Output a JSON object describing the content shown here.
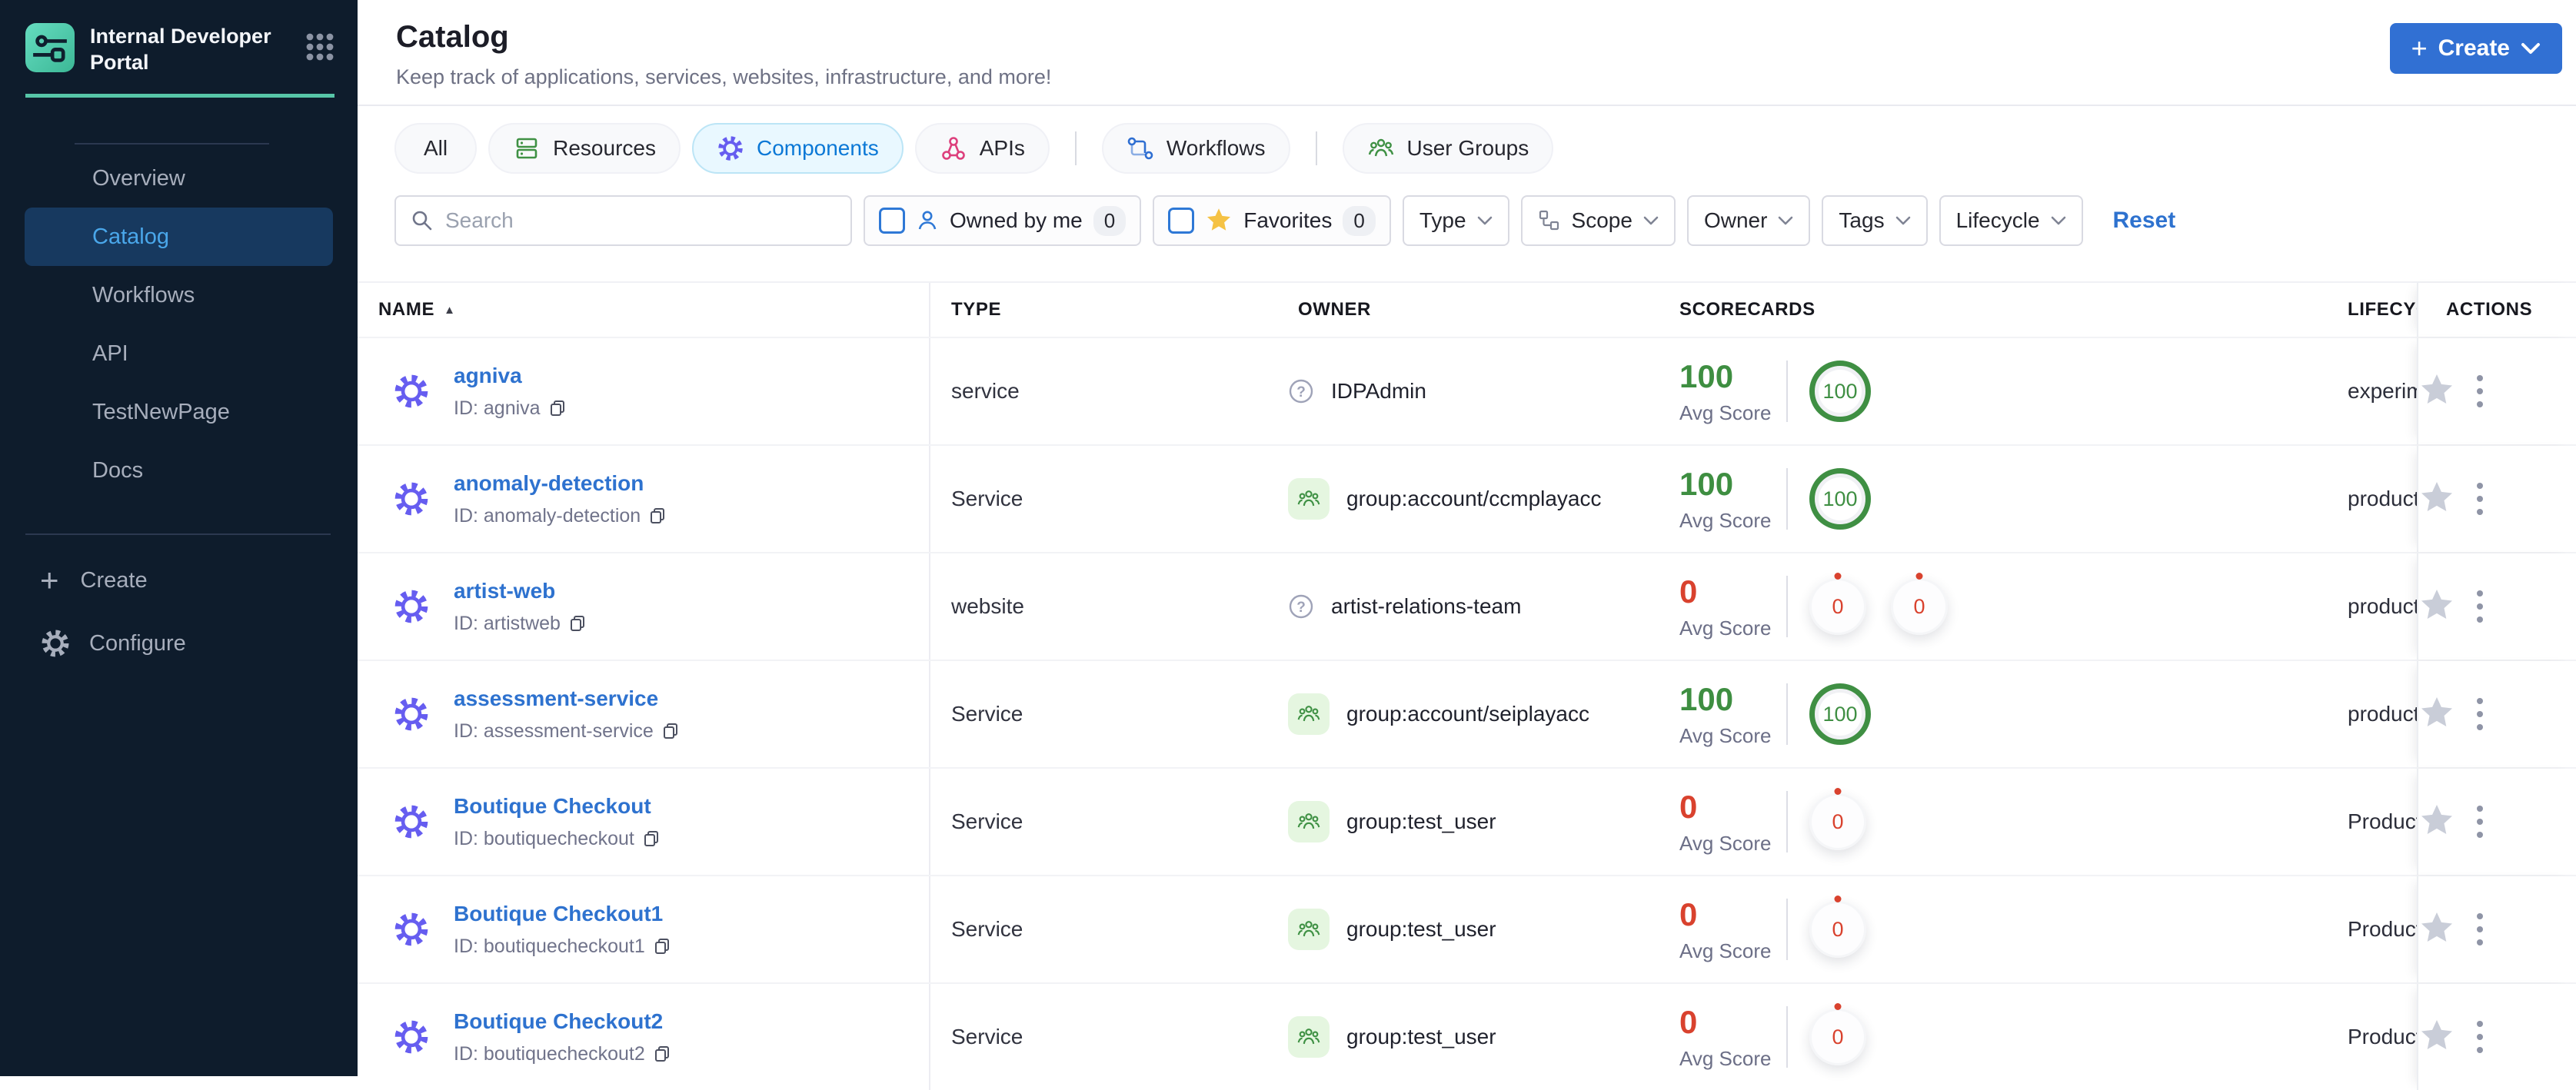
{
  "sidebar": {
    "logo_title": "Internal Developer Portal",
    "nav": [
      "Overview",
      "Catalog",
      "Workflows",
      "API",
      "TestNewPage",
      "Docs"
    ],
    "active_nav": "Catalog",
    "create_label": "Create",
    "configure_label": "Configure"
  },
  "header": {
    "title": "Catalog",
    "subtitle": "Keep track of applications, services, websites, infrastructure, and more!",
    "create_button_label": "Create"
  },
  "tabs": {
    "items": [
      "All",
      "Resources",
      "Components",
      "APIs",
      "Workflows",
      "User Groups"
    ],
    "active": "Components"
  },
  "filters": {
    "search_placeholder": "Search",
    "owned_by_me": {
      "label": "Owned by me",
      "count": "0",
      "checked": false
    },
    "favorites": {
      "label": "Favorites",
      "count": "0",
      "checked": false
    },
    "dropdowns": [
      "Type",
      "Scope",
      "Owner",
      "Tags",
      "Lifecycle"
    ],
    "reset_label": "Reset"
  },
  "table": {
    "columns": [
      "NAME",
      "TYPE",
      "OWNER",
      "SCORECARDS",
      "LIFECYCLE",
      "ACTIONS"
    ],
    "sorted_by": "NAME ascending",
    "avg_score_label": "Avg Score",
    "rows": [
      {
        "name": "agniva",
        "id": "ID: agniva",
        "type": "service",
        "owner": "IDPAdmin",
        "owner_kind": "unknown",
        "score": "100",
        "score_state": "good",
        "circles": [
          "100"
        ],
        "lifecycle": "experimental"
      },
      {
        "name": "anomaly-detection",
        "id": "ID: anomaly-detection",
        "type": "Service",
        "owner": "group:account/ccmplayacc",
        "owner_kind": "group",
        "score": "100",
        "score_state": "good",
        "circles": [
          "100"
        ],
        "lifecycle": "production"
      },
      {
        "name": "artist-web",
        "id": "ID: artistweb",
        "type": "website",
        "owner": "artist-relations-team",
        "owner_kind": "unknown",
        "score": "0",
        "score_state": "bad",
        "circles": [
          "0",
          "0"
        ],
        "lifecycle": "production"
      },
      {
        "name": "assessment-service",
        "id": "ID: assessment-service",
        "type": "Service",
        "owner": "group:account/seiplayacc",
        "owner_kind": "group",
        "score": "100",
        "score_state": "good",
        "circles": [
          "100"
        ],
        "lifecycle": "production"
      },
      {
        "name": "Boutique Checkout",
        "id": "ID: boutiquecheckout",
        "type": "Service",
        "owner": "group:test_user",
        "owner_kind": "group",
        "score": "0",
        "score_state": "bad",
        "circles": [
          "0"
        ],
        "lifecycle": "Production"
      },
      {
        "name": "Boutique Checkout1",
        "id": "ID: boutiquecheckout1",
        "type": "Service",
        "owner": "group:test_user",
        "owner_kind": "group",
        "score": "0",
        "score_state": "bad",
        "circles": [
          "0"
        ],
        "lifecycle": "Production"
      },
      {
        "name": "Boutique Checkout2",
        "id": "ID: boutiquecheckout2",
        "type": "Service",
        "owner": "group:test_user",
        "owner_kind": "group",
        "score": "0",
        "score_state": "bad",
        "circles": [
          "0"
        ],
        "lifecycle": "Production"
      }
    ]
  },
  "icons": {
    "sort_asc": "▲",
    "plus": "+",
    "question_mark": "?"
  },
  "colors": {
    "sidebar_bg": "#0e1c2c",
    "sidebar_active_bg": "#17395f",
    "sidebar_active_text": "#4aa7ea",
    "accent_teal": "#57c6a8",
    "primary_button_blue": "#3170d3",
    "link_blue": "#2e72cf",
    "active_tab_text": "#0b78d6",
    "active_tab_bg": "#e9f8ff",
    "score_green": "#3e8e41",
    "score_red": "#d9422e",
    "gear_purple": "#665df0",
    "resources_green": "#3f9144",
    "apis_pink": "#dd3f7c",
    "favorites_gold": "#f5c244"
  }
}
